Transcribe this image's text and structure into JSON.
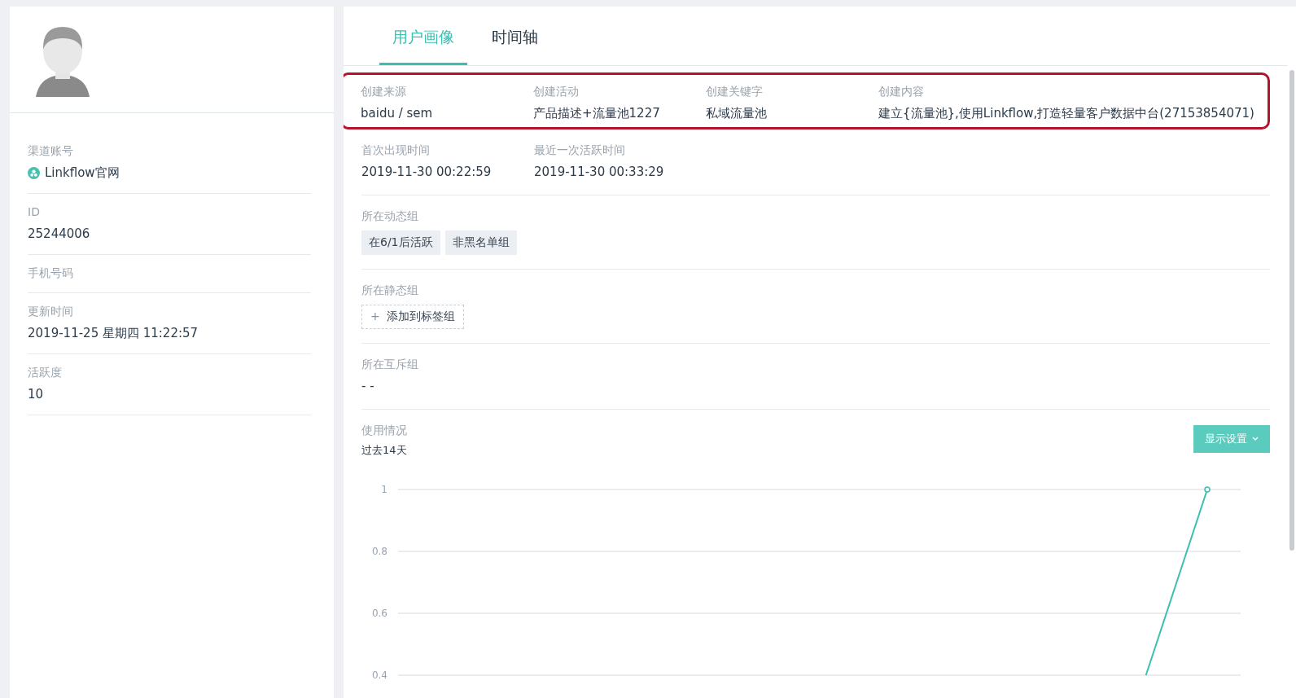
{
  "profile": {
    "fields": [
      {
        "kind": "channel",
        "label": "渠道账号",
        "value": "Linkflow官网"
      },
      {
        "kind": "text",
        "label": "ID",
        "value": "25244006"
      },
      {
        "kind": "text",
        "label": "手机号码"
      },
      {
        "kind": "text",
        "label": "更新时间",
        "value": "2019-11-25 星期四 11:22:57"
      },
      {
        "kind": "text",
        "label": "活跃度",
        "value": "10"
      }
    ]
  },
  "tabs": [
    {
      "label": "用户画像",
      "selected": true
    },
    {
      "label": "时间轴",
      "selected": false
    }
  ],
  "sections": [
    {
      "kind": "fields",
      "highlighted": true,
      "fields": [
        {
          "label": "创建来源",
          "value": "baidu / sem"
        },
        {
          "label": "创建活动",
          "value": "产品描述+流量池1227"
        },
        {
          "label": "创建关键字",
          "value": "私域流量池"
        },
        {
          "label": "创建内容",
          "value": "建立{流量池},使用Linkflow,打造轻量客户数据中台(27153854071)"
        }
      ]
    },
    {
      "kind": "fields",
      "highlighted": false,
      "fields": [
        {
          "label": "首次出现时间",
          "value": "2019-11-30 00:22:59"
        },
        {
          "label": "最近一次活跃时间",
          "value": "2019-11-30 00:33:29"
        }
      ]
    },
    {
      "kind": "tags",
      "label": "所在动态组",
      "tags": [
        "在6/1后活跃",
        "非黑名单组"
      ]
    },
    {
      "kind": "add",
      "label": "所在静态组",
      "button": "添加到标签组",
      "icon": "+"
    },
    {
      "kind": "text",
      "label": "所在互斥组",
      "value": "- -"
    },
    {
      "kind": "chart",
      "label": "使用情况",
      "subtitle": "过去14天",
      "button": "显示设置",
      "chart_data": {
        "type": "line",
        "grid": true,
        "ylim": [
          0.4,
          1
        ],
        "yticks": [
          {
            "value": 0.4,
            "label": "0.4"
          },
          {
            "value": 0.6,
            "label": "0.6"
          },
          {
            "value": 0.8,
            "label": "0.8"
          },
          {
            "value": 1,
            "label": "1"
          }
        ],
        "series": [
          {
            "color": "#3cbfb0",
            "values": [
              null,
              null,
              null,
              null,
              null,
              null,
              null,
              null,
              null,
              null,
              null,
              null,
              0.4,
              1
            ],
            "marker": true
          }
        ]
      }
    }
  ]
}
